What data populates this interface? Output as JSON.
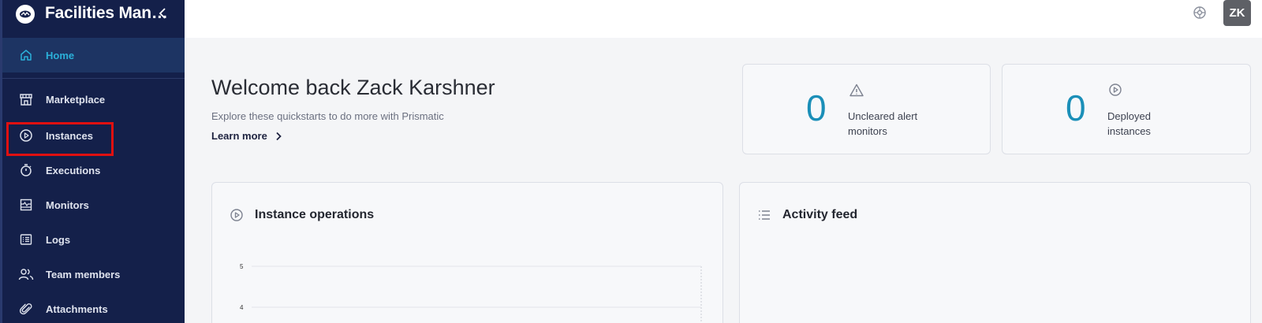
{
  "app": {
    "title": "Facilities Man…"
  },
  "sidebar": {
    "items": [
      {
        "label": "Home",
        "icon": "home-icon"
      },
      {
        "label": "Marketplace",
        "icon": "storefront-icon"
      },
      {
        "label": "Instances",
        "icon": "play-circle-icon"
      },
      {
        "label": "Executions",
        "icon": "stopwatch-icon"
      },
      {
        "label": "Monitors",
        "icon": "monitor-chart-icon"
      },
      {
        "label": "Logs",
        "icon": "logs-icon"
      },
      {
        "label": "Team members",
        "icon": "users-icon"
      },
      {
        "label": "Attachments",
        "icon": "paperclip-icon"
      }
    ]
  },
  "topbar": {
    "avatar_initials": "ZK",
    "settings_icon": "gear-icon"
  },
  "welcome": {
    "title": "Welcome back Zack Karshner",
    "subtitle": "Explore these quickstarts to do more with Prismatic",
    "learn_more": "Learn more"
  },
  "stats": [
    {
      "value": "0",
      "label": "Uncleared alert monitors",
      "icon": "warning-icon"
    },
    {
      "value": "0",
      "label": "Deployed instances",
      "icon": "play-circle-icon"
    }
  ],
  "panels": {
    "instance_operations": {
      "title": "Instance operations",
      "icon": "play-circle-icon"
    },
    "activity_feed": {
      "title": "Activity feed",
      "icon": "list-icon"
    }
  },
  "chart_data": {
    "type": "line",
    "ylabel": "",
    "xlabel": "",
    "visible_y_ticks": [
      "5",
      "4"
    ],
    "grid": true,
    "series": []
  },
  "colors": {
    "sidebar_bg": "#14204a",
    "accent": "#1b8fb8",
    "active_nav_text": "#2bb0d9",
    "highlight": "#e01010"
  }
}
